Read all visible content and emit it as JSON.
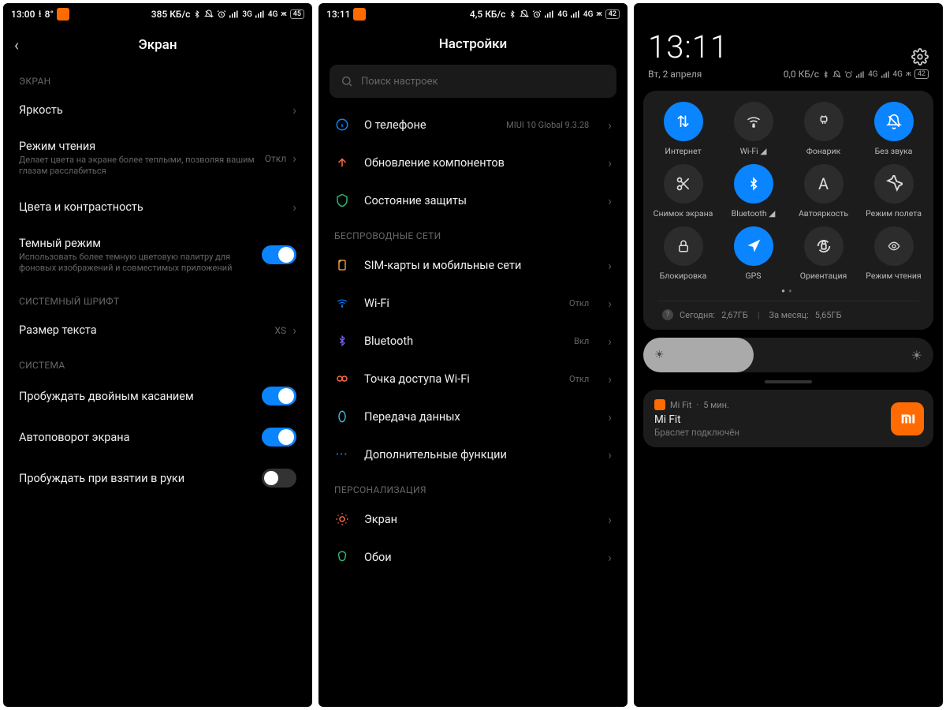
{
  "p1": {
    "status": {
      "time": "13:00",
      "dl": "⭳",
      "temp": "8°",
      "speed": "385 КБ/с",
      "net1": "3G",
      "net2": "4G",
      "bat": "45"
    },
    "title": "Экран",
    "sec_screen": "ЭКРАН",
    "brightness": "Яркость",
    "reading": {
      "t": "Режим чтения",
      "s": "Делает цвета на экране более теплыми, позволяя вашим глазам расслабиться",
      "v": "Откл"
    },
    "colors": "Цвета и контрастность",
    "dark": {
      "t": "Темный режим",
      "s": "Использовать более темную цветовую палитру для фоновых изображений и совместимых приложений"
    },
    "sec_font": "СИСТЕМНЫЙ ШРИФТ",
    "textsize": {
      "t": "Размер текста",
      "v": "XS"
    },
    "sec_sys": "СИСТЕМА",
    "doubletap": "Пробуждать двойным касанием",
    "autorotate": "Автоповорот экрана",
    "lifttowake": "Пробуждать при взятии в руки"
  },
  "p2": {
    "status": {
      "time": "13:11",
      "speed": "4,5 КБ/с",
      "net1": "4G",
      "net2": "4G",
      "bat": "42"
    },
    "title": "Настройки",
    "search_ph": "Поиск настроек",
    "about": {
      "t": "О телефоне",
      "v": "MIUI 10 Global 9.3.28"
    },
    "update": "Обновление компонентов",
    "security": "Состояние защиты",
    "sec_wireless": "БЕСПРОВОДНЫЕ СЕТИ",
    "sim": "SIM-карты и мобильные сети",
    "wifi": {
      "t": "Wi-Fi",
      "v": "Откл"
    },
    "bt": {
      "t": "Bluetooth",
      "v": "Вкл"
    },
    "hotspot": {
      "t": "Точка доступа Wi-Fi",
      "v": "Откл"
    },
    "data": "Передача данных",
    "more": "Дополнительные функции",
    "sec_pers": "ПЕРСОНАЛИЗАЦИЯ",
    "display": "Экран",
    "wallpaper": "Обои"
  },
  "p3": {
    "time": "13:11",
    "date": "Вт, 2 апреля",
    "status": {
      "speed": "0,0 КБ/с",
      "net1": "4G",
      "net2": "4G",
      "bat": "42"
    },
    "tiles": [
      {
        "name": "internet",
        "label": "Интернет",
        "on": true,
        "glyph": "⇅"
      },
      {
        "name": "wifi",
        "label": "Wi-Fi",
        "on": false,
        "glyph": "wifi",
        "tri": true
      },
      {
        "name": "flashlight",
        "label": "Фонарик",
        "on": false,
        "glyph": "flash"
      },
      {
        "name": "mute",
        "label": "Без звука",
        "on": true,
        "glyph": "bell-off"
      },
      {
        "name": "screenshot",
        "label": "Снимок экрана",
        "on": false,
        "glyph": "scissors"
      },
      {
        "name": "bluetooth",
        "label": "Bluetooth",
        "on": true,
        "glyph": "bt",
        "tri": true
      },
      {
        "name": "autobright",
        "label": "Автояркость",
        "on": false,
        "glyph": "A"
      },
      {
        "name": "airplane",
        "label": "Режим полета",
        "on": false,
        "glyph": "plane"
      },
      {
        "name": "lock",
        "label": "Блокировка",
        "on": false,
        "glyph": "lock"
      },
      {
        "name": "gps",
        "label": "GPS",
        "on": true,
        "glyph": "nav"
      },
      {
        "name": "orientation",
        "label": "Ориентация",
        "on": false,
        "glyph": "rotate-lock"
      },
      {
        "name": "reading",
        "label": "Режим чтения",
        "on": false,
        "glyph": "eye"
      }
    ],
    "usage": {
      "today_l": "Сегодня:",
      "today_v": "2,67ГБ",
      "month_l": "За месяц:",
      "month_v": "5,65ГБ"
    },
    "notif": {
      "app": "Mi Fit",
      "when": "5 мин.",
      "title": "Mi Fit",
      "sub": "Браслет подключён"
    }
  }
}
